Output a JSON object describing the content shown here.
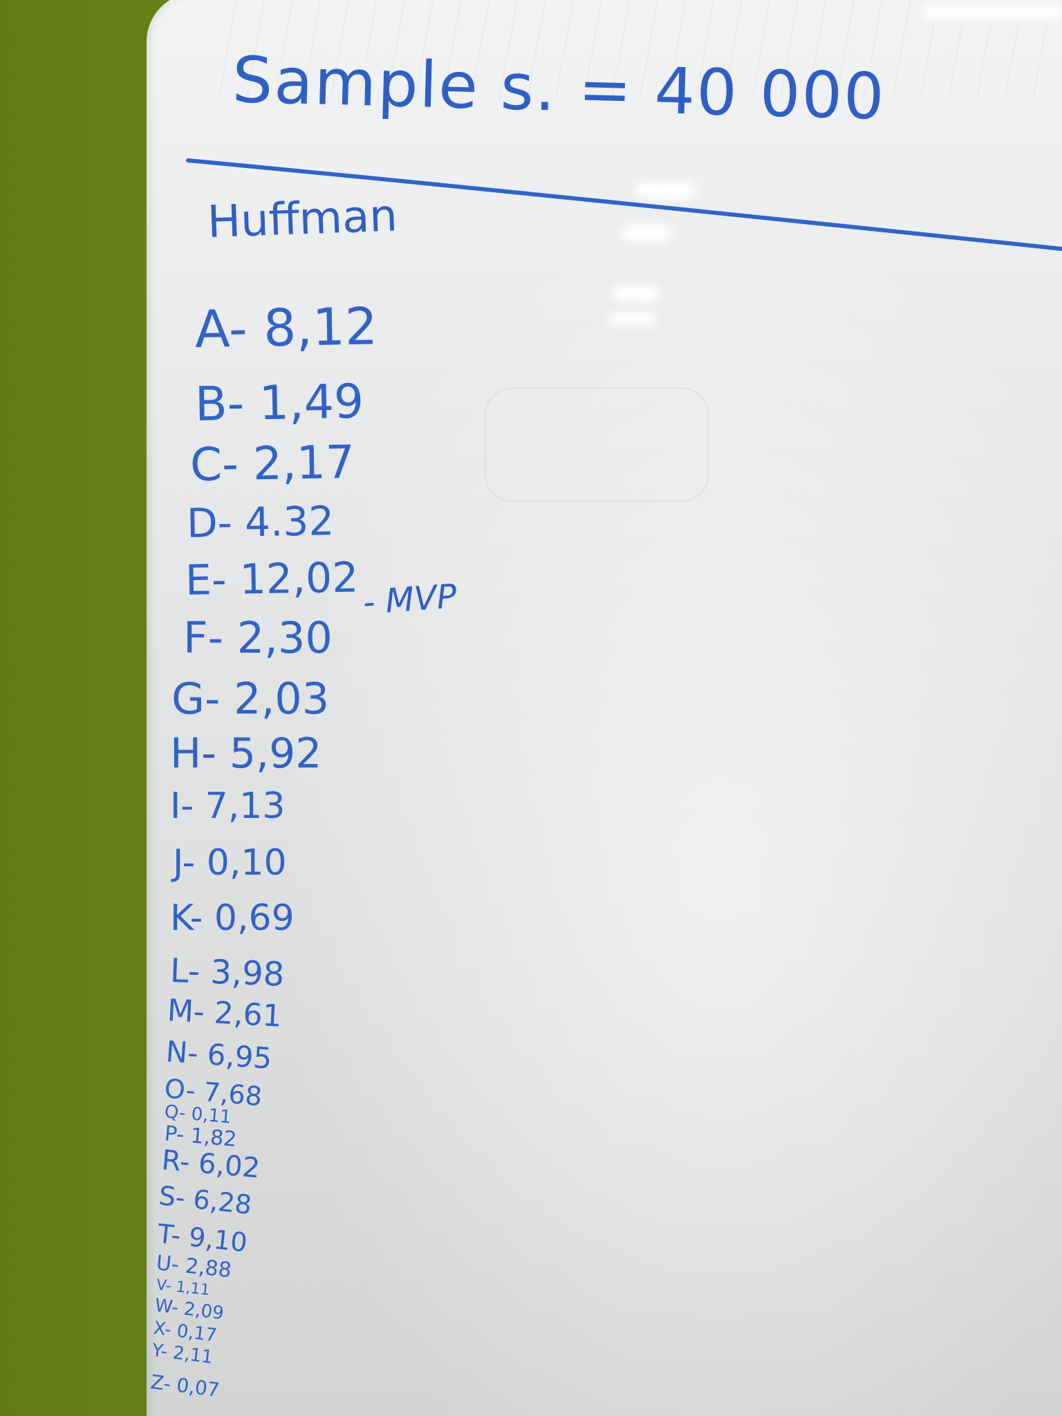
{
  "board": {
    "title": "Sample s. = 40 000",
    "subtitle": "Huffman",
    "note": "- MVP",
    "ink_color": "#3163c7",
    "frame_color": "#6d8a1c"
  },
  "entries": [
    {
      "text": "A- 8,12"
    },
    {
      "text": "B- 1,49"
    },
    {
      "text": "C- 2,17"
    },
    {
      "text": "D- 4.32"
    },
    {
      "text": "E- 12,02"
    },
    {
      "text": "F- 2,30"
    },
    {
      "text": "G- 2,03"
    },
    {
      "text": "H- 5,92"
    },
    {
      "text": "I- 7,13"
    },
    {
      "text": "J- 0,10"
    },
    {
      "text": "K- 0,69"
    },
    {
      "text": "L- 3,98"
    },
    {
      "text": "M- 2,61"
    },
    {
      "text": "N- 6,95"
    },
    {
      "text": "O- 7,68"
    },
    {
      "text": "Q- 0,11"
    },
    {
      "text": "P- 1,82"
    },
    {
      "text": "R- 6,02"
    },
    {
      "text": "S- 6,28"
    },
    {
      "text": "T- 9,10"
    },
    {
      "text": "U- 2,88"
    },
    {
      "text": "V- 1,11"
    },
    {
      "text": "W- 2,09"
    },
    {
      "text": "X- 0,17"
    },
    {
      "text": "Y- 2,11"
    },
    {
      "text": "Z- 0,07"
    }
  ]
}
